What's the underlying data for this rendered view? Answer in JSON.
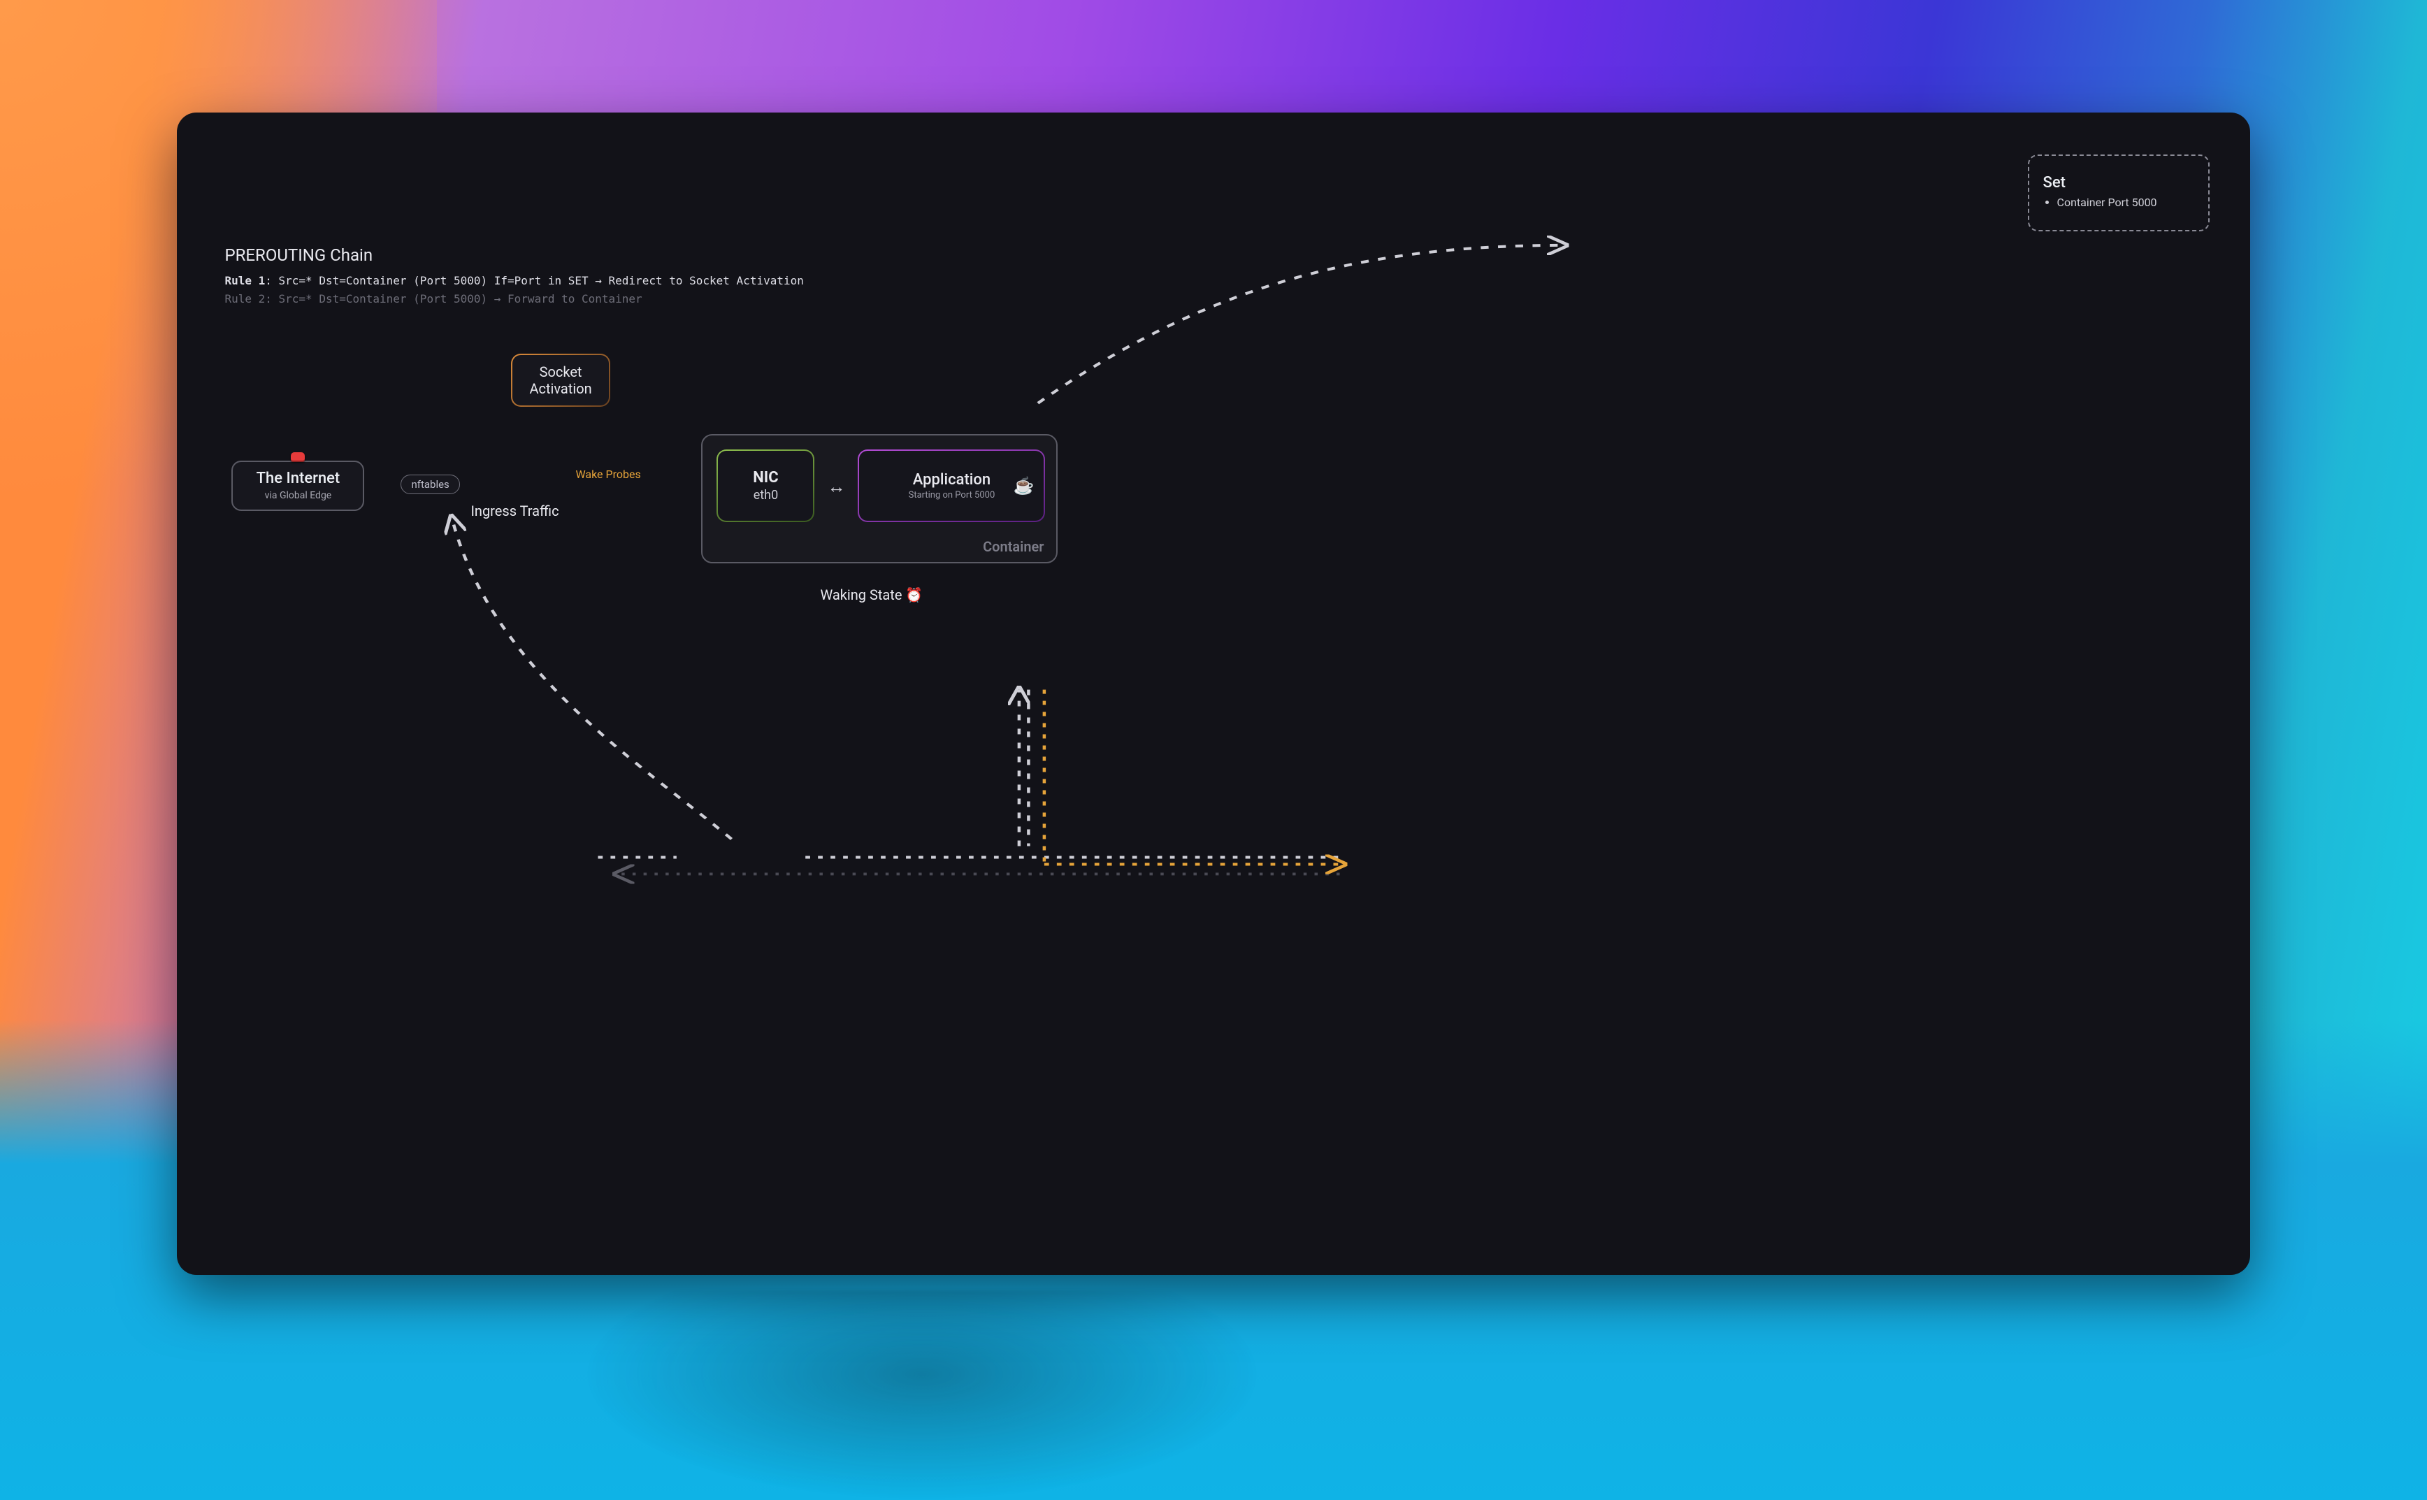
{
  "set": {
    "title": "Set",
    "items": [
      "Container Port 5000"
    ]
  },
  "chain": {
    "title": "PREROUTING Chain",
    "rule1_label": "Rule 1",
    "rule1_body": ": Src=* Dst=Container (Port 5000) If=Port in SET → Redirect to Socket Activation",
    "rule2_label": "Rule 2",
    "rule2_body": ": Src=* Dst=Container (Port 5000) → Forward to Container"
  },
  "internet": {
    "title": "The Internet",
    "sub": "via Global Edge"
  },
  "nftables_label": "nftables",
  "socket_activation": {
    "line1": "Socket",
    "line2": "Activation"
  },
  "labels": {
    "ingress": "Ingress Traffic",
    "wake_probes": "Wake Probes"
  },
  "container": {
    "label": "Container",
    "nic_title": "NIC",
    "nic_sub": "eth0",
    "app_title": "Application",
    "app_sub": "Starting on Port 5000",
    "app_emoji": "☕"
  },
  "state": {
    "label": "Waking State",
    "emoji": "⏰"
  }
}
